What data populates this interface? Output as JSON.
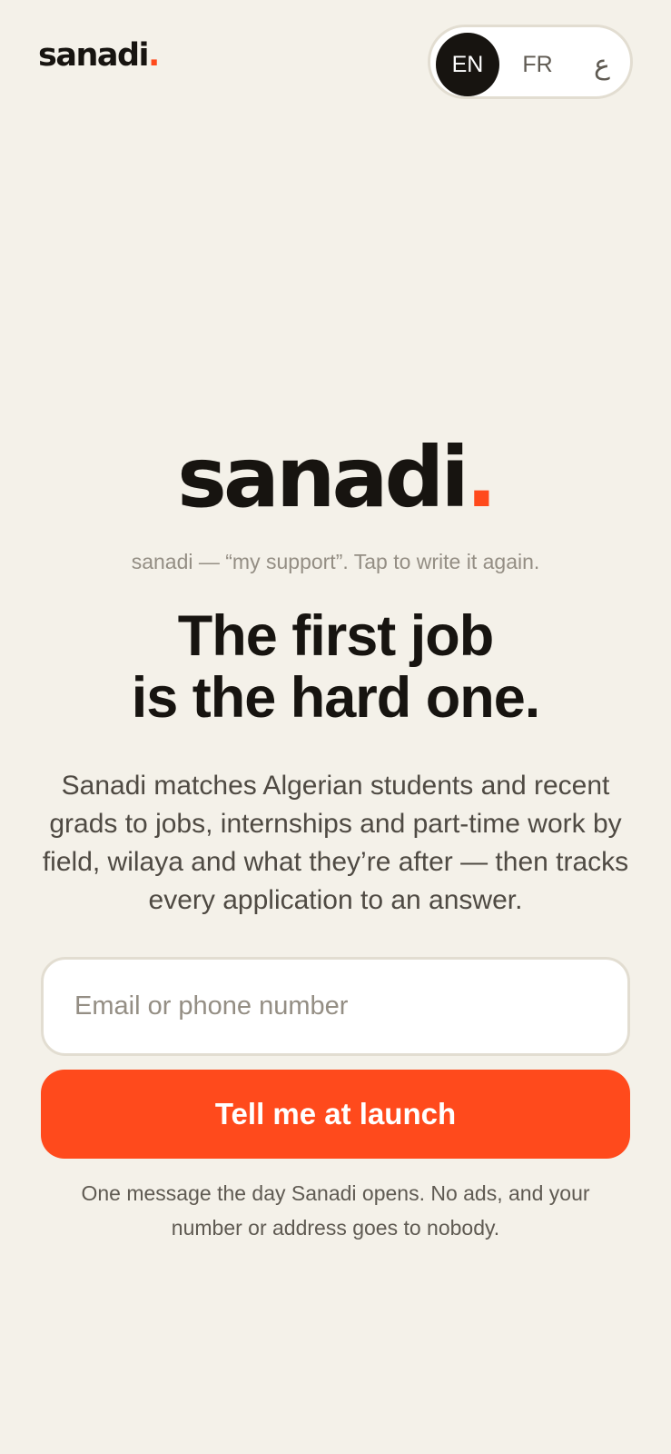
{
  "header": {
    "logo_text": "sanadi",
    "logo_dot": "."
  },
  "language_switcher": {
    "active": "EN",
    "options": [
      {
        "label": "EN"
      },
      {
        "label": "FR"
      },
      {
        "label": "ع"
      }
    ]
  },
  "hero": {
    "logo_text": "sanadi",
    "logo_dot": ".",
    "caption": "sanadi — “my support”. Tap to write it again.",
    "headline_line1": "The first job",
    "headline_line2": "is the hard one.",
    "description": "Sanadi matches Algerian students and recent grads to jobs, internships and part-time work by field, wilaya and what they’re after — then tracks every application to an answer."
  },
  "signup": {
    "input_placeholder": "Email or phone number",
    "input_value": "",
    "button_label": "Tell me at launch",
    "footnote": "One message the day Sanadi opens. No ads, and your number or address goes to nobody."
  },
  "colors": {
    "background": "#f4f1e9",
    "text": "#171410",
    "accent": "#ff4a1c",
    "muted": "#948e84",
    "border": "#e2ddd1"
  }
}
